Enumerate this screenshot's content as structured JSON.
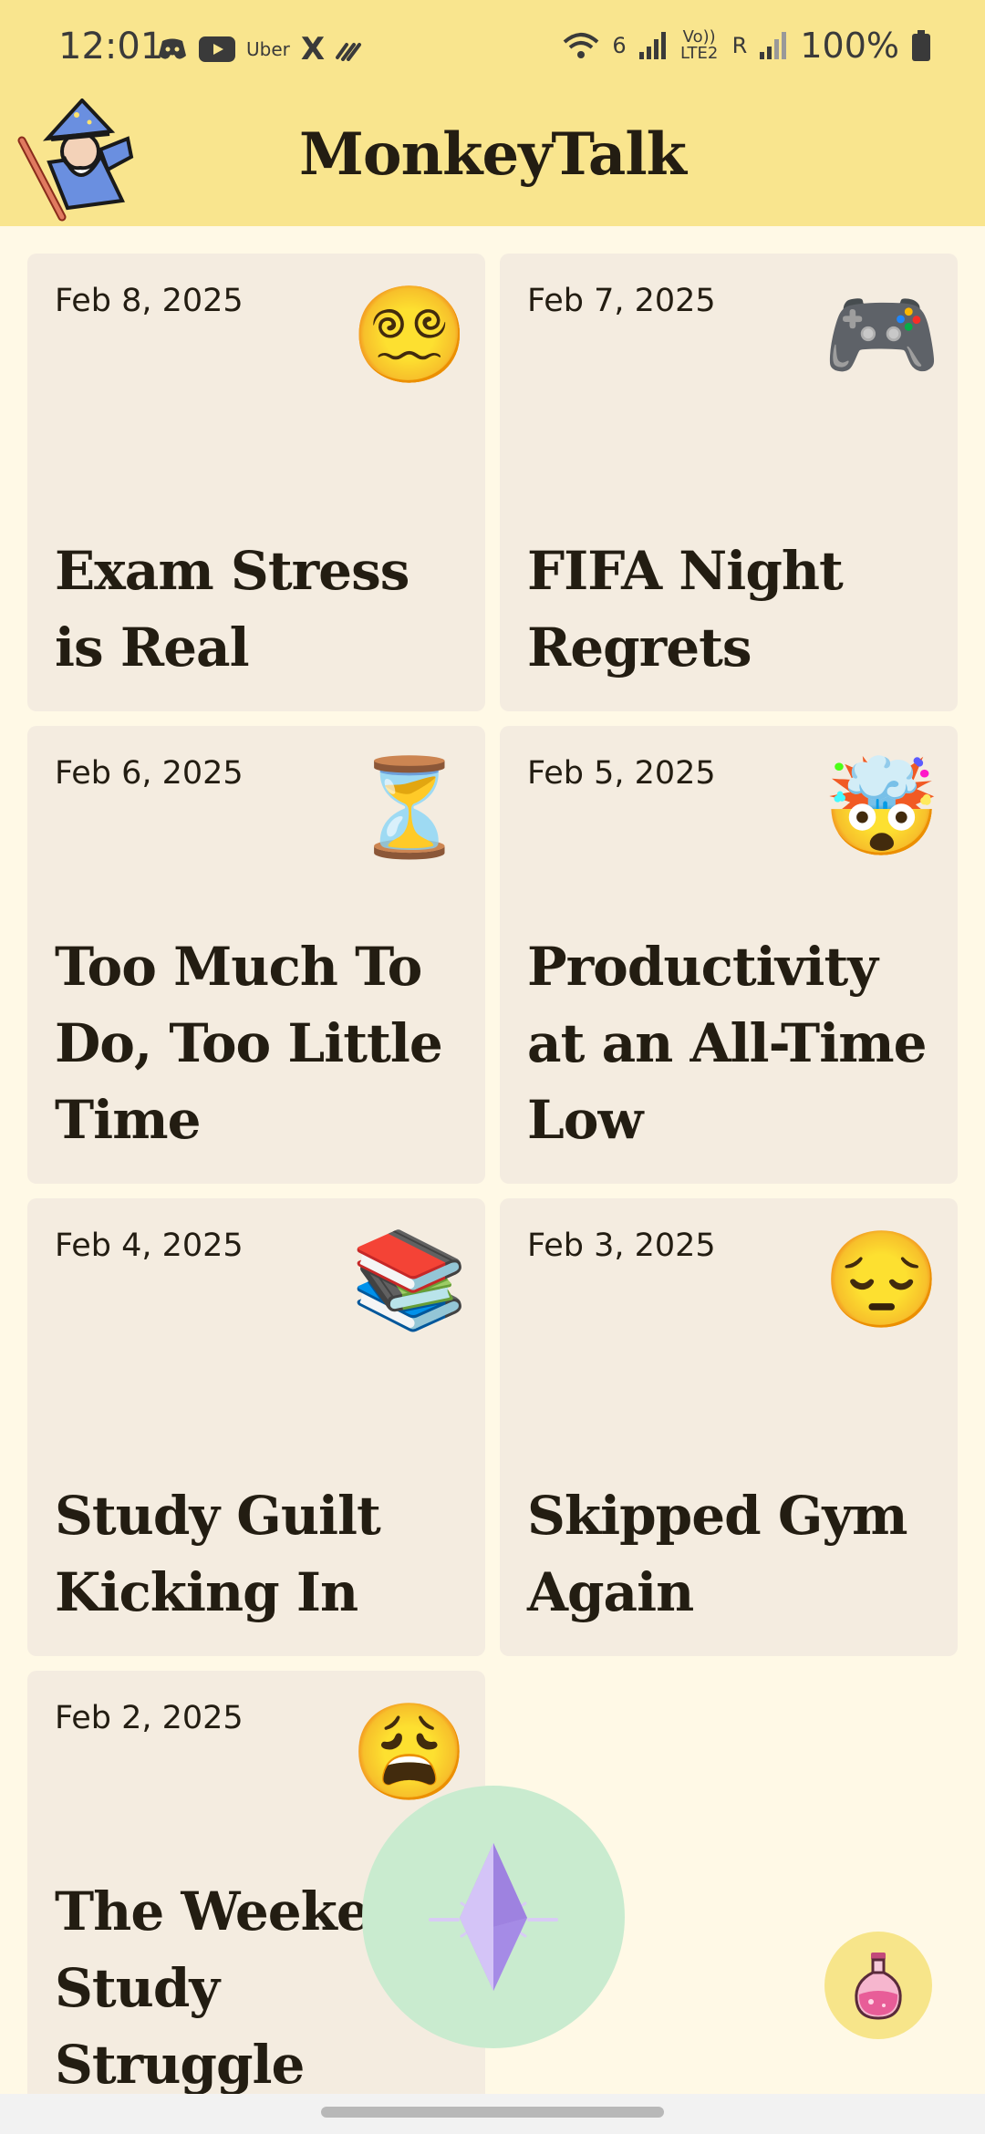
{
  "status_bar": {
    "time": "12:01",
    "left_icons": [
      "discord-icon",
      "youtube-icon",
      "Uber",
      "X",
      "activity-icon"
    ],
    "network_labels": [
      "6",
      "Vo)) LTE2",
      "R"
    ],
    "battery": "100%"
  },
  "header": {
    "title": "MonkeyTalk",
    "avatar_icon": "wizard-icon"
  },
  "cards": [
    {
      "date": "Feb 8, 2025",
      "emoji": "😵‍💫",
      "icon_name": "dizzy-face-icon",
      "title": "Exam Stress is Real"
    },
    {
      "date": "Feb 7, 2025",
      "emoji": "🎮",
      "icon_name": "game-controller-icon",
      "title": "FIFA Night Regrets"
    },
    {
      "date": "Feb 6, 2025",
      "emoji": "⏳",
      "icon_name": "hourglass-icon",
      "title": "Too Much To Do, Too Little Time"
    },
    {
      "date": "Feb 5, 2025",
      "emoji": "🤯",
      "icon_name": "exploding-head-icon",
      "title": "Productivity at an All-Time Low"
    },
    {
      "date": "Feb 4, 2025",
      "emoji": "📚",
      "icon_name": "books-icon",
      "title": "Study Guilt Kicking In"
    },
    {
      "date": "Feb 3, 2025",
      "emoji": "😔",
      "icon_name": "pensive-face-icon",
      "title": "Skipped Gym Again"
    },
    {
      "date": "Feb 2, 2025",
      "emoji": "😩",
      "icon_name": "weary-face-icon",
      "title": "The Weekend Study Struggle"
    }
  ],
  "fab_main": {
    "icon": "crystal-icon",
    "color": "#C9EBCF"
  },
  "fab_secondary": {
    "icon": "potion-icon",
    "color": "#F7E58A"
  },
  "colors": {
    "header_bg": "#F9E58E",
    "page_bg": "#FFF9E6",
    "card_bg": "#F4ECE0",
    "text": "#231d12"
  }
}
